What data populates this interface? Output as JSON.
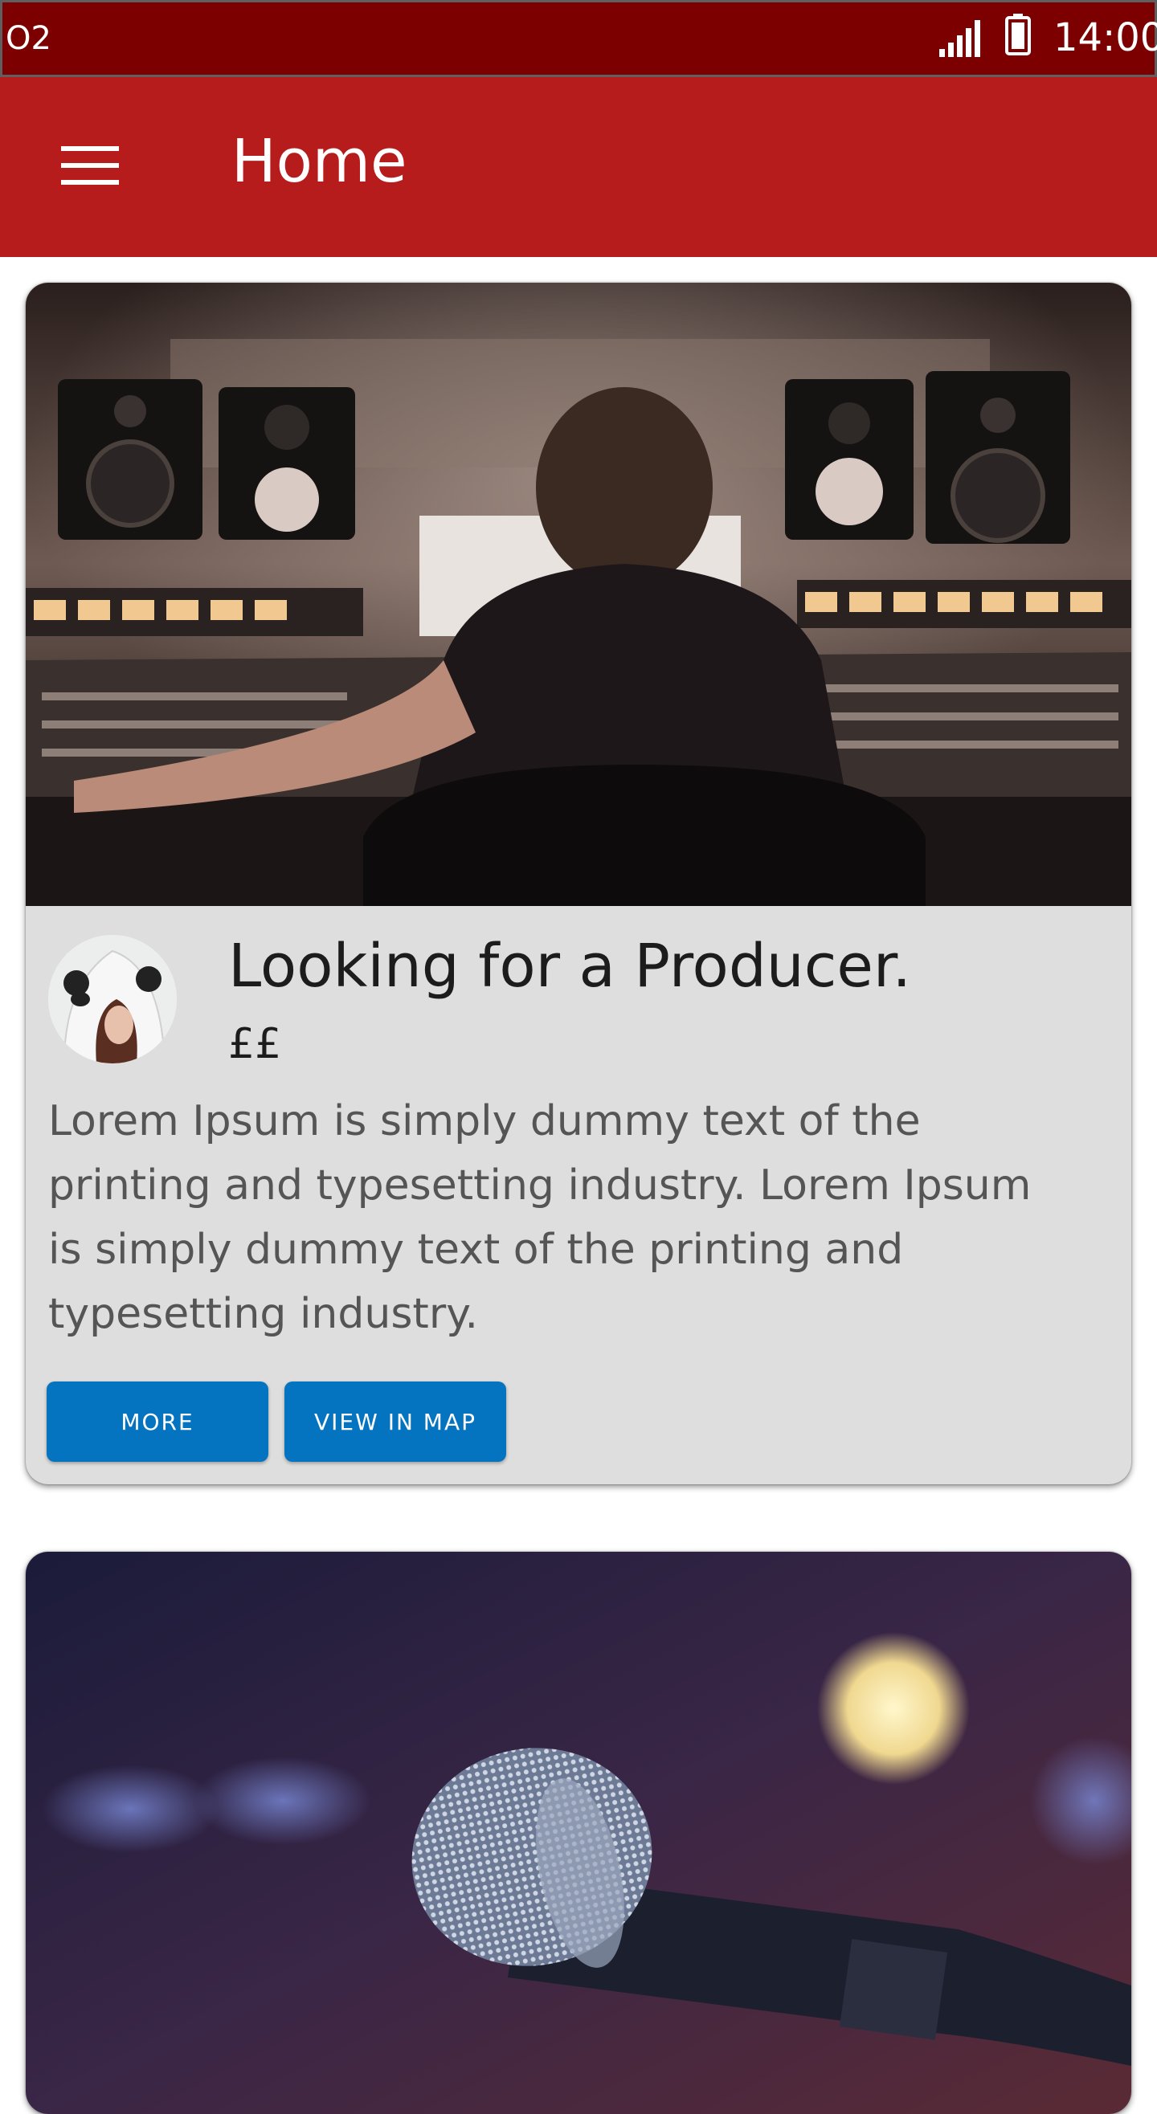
{
  "status_bar": {
    "carrier": "O2",
    "time": "14:00",
    "background": "#7c0000"
  },
  "app_bar": {
    "title": "Home",
    "menu_icon": "hamburger-menu-icon",
    "background": "#b71c1c"
  },
  "cards": [
    {
      "image": "music-studio-producer-photo",
      "avatar": "user-avatar-photo",
      "title": "Looking for a Producer.",
      "price": "££",
      "description": "Lorem Ipsum is simply dummy text of the printing and typesetting industry. Lorem Ipsum is simply dummy text of the printing and typesetting industry.",
      "buttons": {
        "more": "MORE",
        "map": "VIEW IN MAP"
      }
    },
    {
      "image": "microphone-stage-photo"
    }
  ],
  "colors": {
    "accent_button": "#0574c0",
    "card_background": "#dedede"
  }
}
